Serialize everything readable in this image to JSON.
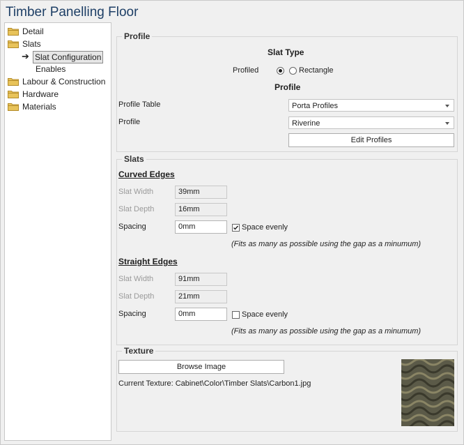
{
  "window": {
    "title": "Timber Panelling Floor"
  },
  "sidebar": {
    "items": [
      {
        "label": "Detail"
      },
      {
        "label": "Slats"
      },
      {
        "label": "Slat Configuration"
      },
      {
        "label": "Enables"
      },
      {
        "label": "Labour & Construction"
      },
      {
        "label": "Hardware"
      },
      {
        "label": "Materials"
      }
    ]
  },
  "profile": {
    "group_title": "Profile",
    "slat_type_heading": "Slat Type",
    "slat_type_label": "Profiled",
    "options": [
      {
        "label": "",
        "checked": true
      },
      {
        "label": "Rectangle",
        "checked": false
      }
    ],
    "profile_heading": "Profile",
    "profile_table_label": "Profile Table",
    "profile_table_value": "Porta Profiles",
    "profile_label": "Profile",
    "profile_value": "Riverine",
    "edit_button": "Edit Profiles"
  },
  "slats": {
    "group_title": "Slats",
    "curved": {
      "heading": "Curved Edges",
      "slat_width_label": "Slat Width",
      "slat_width_value": "39mm",
      "slat_depth_label": "Slat Depth",
      "slat_depth_value": "16mm",
      "spacing_label": "Spacing",
      "spacing_value": "0mm",
      "space_evenly_label": "Space evenly",
      "space_evenly_checked": true,
      "note": "(Fits as many as possible using the gap as a minumum)"
    },
    "straight": {
      "heading": "Straight Edges",
      "slat_width_label": "Slat Width",
      "slat_width_value": "91mm",
      "slat_depth_label": "Slat Depth",
      "slat_depth_value": "21mm",
      "spacing_label": "Spacing",
      "spacing_value": "0mm",
      "space_evenly_label": "Space evenly",
      "space_evenly_checked": false,
      "note": "(Fits as many as possible using the gap as a minumum)"
    }
  },
  "texture": {
    "group_title": "Texture",
    "browse_button": "Browse Image",
    "current_label": "Current Texture: Cabinet\\Color\\Timber Slats\\Carbon1.jpg"
  },
  "colors": {
    "title": "#1e3f66",
    "folder": "#e8c35a",
    "folder_dark": "#b38b2a",
    "texture_base": "#5b5a48"
  }
}
